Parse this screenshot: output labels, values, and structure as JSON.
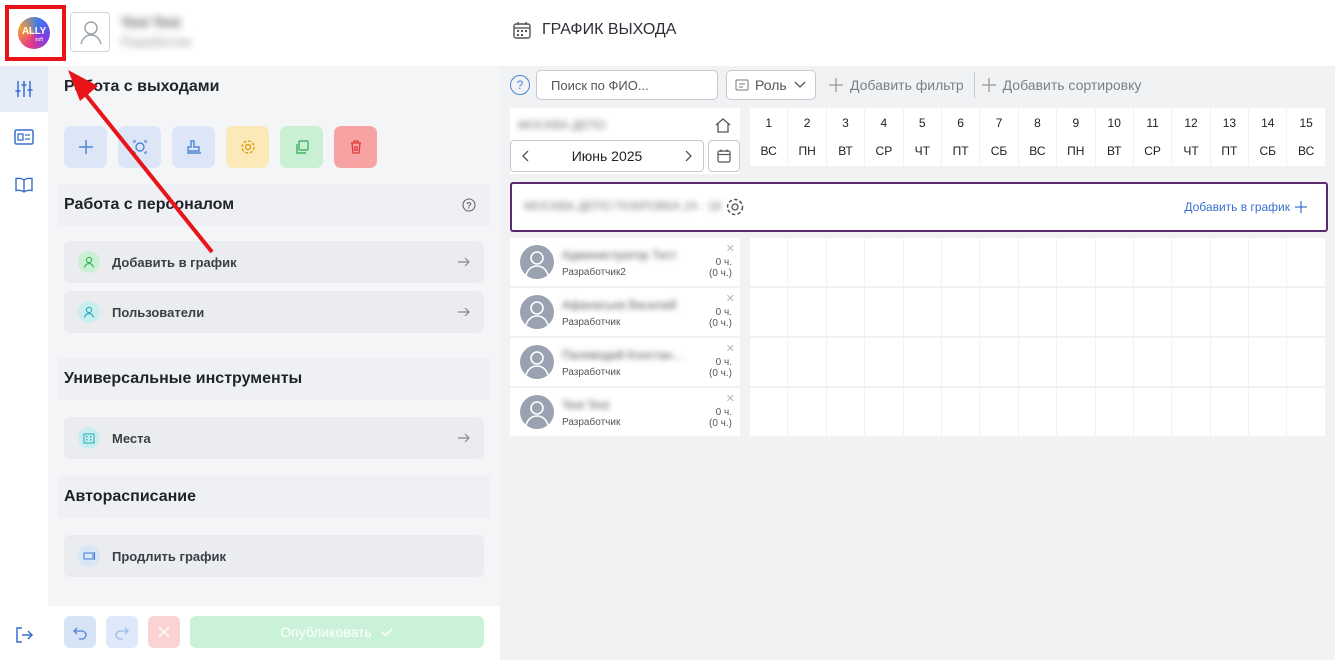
{
  "logo": {
    "brand": "ALLY",
    "sub": "soft"
  },
  "user": {
    "name": "Test Test",
    "role": "Разработчик"
  },
  "page_title": "ГРАФИК ВЫХОДА",
  "panel": {
    "section_exits": "Работа с выходами",
    "section_staff": "Работа с персоналом",
    "staff_items": [
      {
        "label": "Добавить в график"
      },
      {
        "label": "Пользователи"
      }
    ],
    "section_tools": "Универсальные инструменты",
    "tool_items": [
      {
        "label": "Места"
      }
    ],
    "section_auto": "Авторасписание",
    "auto_items": [
      {
        "label": "Продлить график"
      }
    ]
  },
  "bottom": {
    "publish_label": "Опубликовать"
  },
  "filters": {
    "help": "?",
    "search_placeholder": "Поиск по ФИО...",
    "role_label": "Роль",
    "add_filter": "Добавить фильтр",
    "add_sort": "Добавить сортировку"
  },
  "calendar": {
    "org_name": "МОСКВА ДЕПО",
    "month_label": "Июнь 2025",
    "days": [
      {
        "n": "1",
        "w": "ВС"
      },
      {
        "n": "2",
        "w": "ПН"
      },
      {
        "n": "3",
        "w": "ВТ"
      },
      {
        "n": "4",
        "w": "СР"
      },
      {
        "n": "5",
        "w": "ЧТ"
      },
      {
        "n": "6",
        "w": "ПТ"
      },
      {
        "n": "7",
        "w": "СБ"
      },
      {
        "n": "8",
        "w": "ВС"
      },
      {
        "n": "9",
        "w": "ПН"
      },
      {
        "n": "10",
        "w": "ВТ"
      },
      {
        "n": "11",
        "w": "СР"
      },
      {
        "n": "12",
        "w": "ЧТ"
      },
      {
        "n": "13",
        "w": "ПТ"
      },
      {
        "n": "14",
        "w": "СБ"
      },
      {
        "n": "15",
        "w": "ВС"
      }
    ]
  },
  "group": {
    "name": "МОСКВА ДЕПО ПОКРОВКА 24 - 18",
    "add_label": "Добавить в график"
  },
  "employees": [
    {
      "name": "Администратор Тест",
      "role": "Разработчик2",
      "hours": "0 ч.",
      "hours2": "(0 ч.)"
    },
    {
      "name": "Афанасьев Василий",
      "role": "Разработчик",
      "hours": "0 ч.",
      "hours2": "(0 ч.)"
    },
    {
      "name": "Паливодий Констан...",
      "role": "Разработчик",
      "hours": "0 ч.",
      "hours2": "(0 ч.)"
    },
    {
      "name": "Test Test",
      "role": "Разработчик",
      "hours": "0 ч.",
      "hours2": "(0 ч.)"
    }
  ],
  "colors": {
    "accent": "#4e86d4",
    "group_border": "#5b2a6e",
    "annotation": "#e8141a",
    "publish": "#c9f2d8"
  }
}
